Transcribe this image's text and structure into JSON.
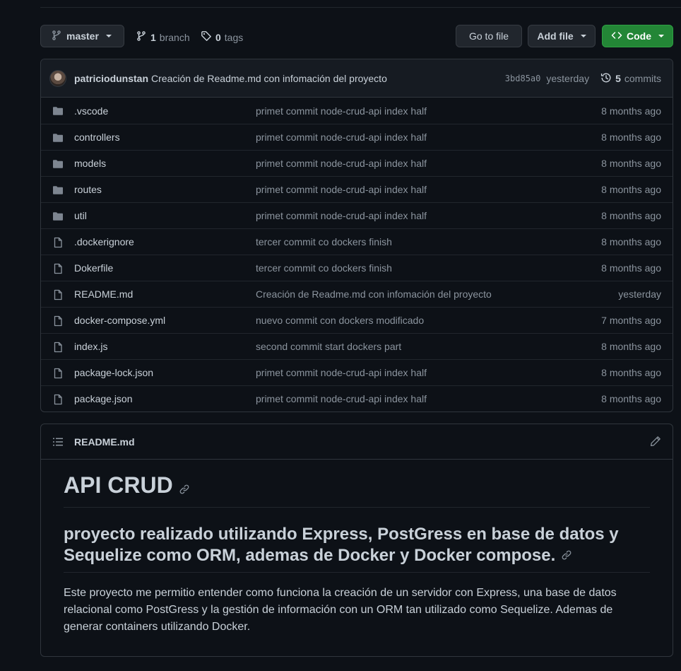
{
  "toolbar": {
    "branch_name": "master",
    "branches_count": "1",
    "branches_label": "branch",
    "tags_count": "0",
    "tags_label": "tags",
    "go_to_file": "Go to file",
    "add_file": "Add file",
    "code": "Code"
  },
  "commit": {
    "author": "patriciodunstan",
    "message": "Creación de Readme.md con infomación del proyecto",
    "sha": "3bd85a0",
    "time": "yesterday",
    "commits_count": "5",
    "commits_label": "commits"
  },
  "files": [
    {
      "type": "folder",
      "name": ".vscode",
      "message": "primet commit node-crud-api index half",
      "age": "8 months ago"
    },
    {
      "type": "folder",
      "name": "controllers",
      "message": "primet commit node-crud-api index half",
      "age": "8 months ago"
    },
    {
      "type": "folder",
      "name": "models",
      "message": "primet commit node-crud-api index half",
      "age": "8 months ago"
    },
    {
      "type": "folder",
      "name": "routes",
      "message": "primet commit node-crud-api index half",
      "age": "8 months ago"
    },
    {
      "type": "folder",
      "name": "util",
      "message": "primet commit node-crud-api index half",
      "age": "8 months ago"
    },
    {
      "type": "file",
      "name": ".dockerignore",
      "message": "tercer commit co dockers finish",
      "age": "8 months ago"
    },
    {
      "type": "file",
      "name": "Dokerfile",
      "message": "tercer commit co dockers finish",
      "age": "8 months ago"
    },
    {
      "type": "file",
      "name": "README.md",
      "message": "Creación de Readme.md con infomación del proyecto",
      "age": "yesterday"
    },
    {
      "type": "file",
      "name": "docker-compose.yml",
      "message": "nuevo commit con dockers modificado",
      "age": "7 months ago"
    },
    {
      "type": "file",
      "name": "index.js",
      "message": "second commit start dockers part",
      "age": "8 months ago"
    },
    {
      "type": "file",
      "name": "package-lock.json",
      "message": "primet commit node-crud-api index half",
      "age": "8 months ago"
    },
    {
      "type": "file",
      "name": "package.json",
      "message": "primet commit node-crud-api index half",
      "age": "8 months ago"
    }
  ],
  "readme": {
    "filename": "README.md",
    "h1": "API CRUD",
    "h2": "proyecto realizado utilizando Express, PostGress en base de datos y Sequelize como ORM, ademas de Docker y Docker compose.",
    "paragraph": "Este proyecto me permitio entender como funciona la creación de un servidor con Express, una base de datos relacional como PostGress y la gestión de información con un ORM tan utilizado como Sequelize. Ademas de generar containers utilizando Docker."
  },
  "colors": {
    "background": "#0d1117",
    "code_button": "#238636",
    "folder_icon": "#7d8590",
    "muted_text": "#8b949e"
  }
}
